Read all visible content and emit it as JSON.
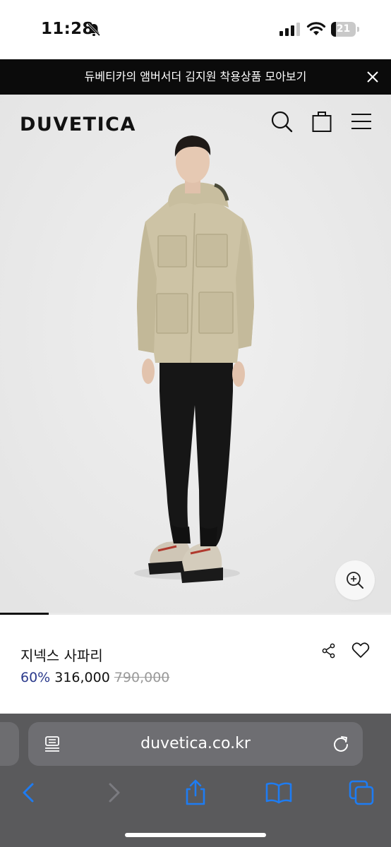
{
  "status_bar": {
    "time": "11:28",
    "battery": "21",
    "battery_level": 0.21
  },
  "announcement": {
    "text": "듀베티카의 앰버서더 김지원 착용상품 모아보기"
  },
  "header": {
    "logo": "DUVETICA"
  },
  "icons": {
    "bell_off": "bell-slash-icon",
    "signal": "cellular-signal-icon",
    "wifi": "wifi-icon",
    "close": "close-icon",
    "search": "search-icon",
    "bag": "shopping-bag-icon",
    "menu": "hamburger-menu-icon",
    "zoom": "zoom-in-icon",
    "share": "share-icon",
    "heart": "heart-icon",
    "reader": "reader-mode-icon",
    "reload": "reload-icon",
    "back": "chevron-left-icon",
    "forward": "chevron-right-icon",
    "safari_share": "share-upload-icon",
    "bookmarks": "book-icon",
    "tabs": "tabs-icon"
  },
  "product": {
    "name": "지넥스 사파리",
    "discount": "60%",
    "sale_price": "316,000",
    "original_price": "790,000"
  },
  "carousel": {
    "progress": 0.125
  },
  "browser": {
    "url": "duvetica.co.kr"
  },
  "colors": {
    "discount": "#2b3a8c",
    "announcement_bg": "#0b0b0b",
    "toolbar_accent": "#1e7cf2"
  }
}
